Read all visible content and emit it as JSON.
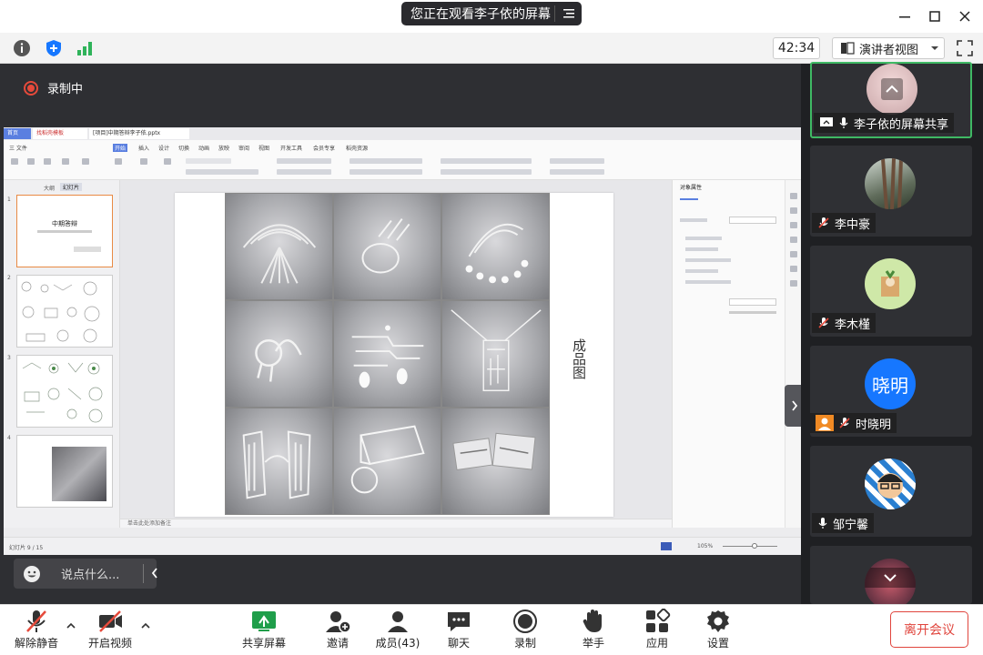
{
  "title_bar": {
    "share_notice": "您正在观看李子依的屏幕",
    "menu_icon": "list-menu-icon",
    "controls": [
      "minimize-icon",
      "maximize-icon",
      "close-icon"
    ]
  },
  "toolbar": {
    "icons": [
      "info-icon",
      "shield-icon",
      "signal-icon"
    ],
    "timer": "42:34",
    "view_mode": "演讲者视图",
    "fullscreen_icon": "fullscreen-icon"
  },
  "stage": {
    "recording_label": "录制中",
    "slide_title": "成品图",
    "chat_placeholder": "说点什么..."
  },
  "shared_window": {
    "tabs": [
      "首页",
      "找稻壳模板",
      "[项目]中期答辩李子依.pptx"
    ],
    "menus": [
      "三 文件",
      "开始",
      "插入",
      "设计",
      "切换",
      "动画",
      "放映",
      "审阅",
      "视图",
      "开发工具",
      "会员专享",
      "稻壳资源"
    ],
    "left_tabs": [
      "大纲",
      "幻灯片"
    ],
    "thumb_numbers": [
      "1",
      "2",
      "3",
      "4"
    ],
    "thumb1_title": "中期答辩",
    "property_panel_title": "对象属性",
    "status_left": "幻灯片 9 / 15",
    "notes_hint": "单击此处添加备注",
    "zoom": "105%"
  },
  "participants": [
    {
      "name": "李子依的屏幕共享",
      "active": true,
      "sharing": true
    },
    {
      "name": "李中豪",
      "muted": true
    },
    {
      "name": "李木槿",
      "muted": true
    },
    {
      "name": "时晓明",
      "muted": true,
      "avatar_text": "晓明"
    },
    {
      "name": "邹宁馨",
      "muted": false
    }
  ],
  "bottom_bar": {
    "buttons": [
      {
        "label": "解除静音",
        "icon": "mic-muted-icon"
      },
      {
        "label": "开启视频",
        "icon": "camera-off-icon"
      },
      {
        "label": "共享屏幕",
        "icon": "share-screen-icon"
      },
      {
        "label": "邀请",
        "icon": "invite-icon"
      },
      {
        "label": "成员(43)",
        "icon": "members-icon"
      },
      {
        "label": "聊天",
        "icon": "chat-icon"
      },
      {
        "label": "录制",
        "icon": "record-icon"
      },
      {
        "label": "举手",
        "icon": "raise-hand-icon"
      },
      {
        "label": "应用",
        "icon": "apps-icon"
      },
      {
        "label": "设置",
        "icon": "settings-icon"
      }
    ],
    "leave": "离开会议"
  },
  "colors": {
    "accent_green": "#3fb964",
    "leave_red": "#e0453d",
    "recording_red": "#e64a3b",
    "avatar_blue": "#1677ff"
  }
}
